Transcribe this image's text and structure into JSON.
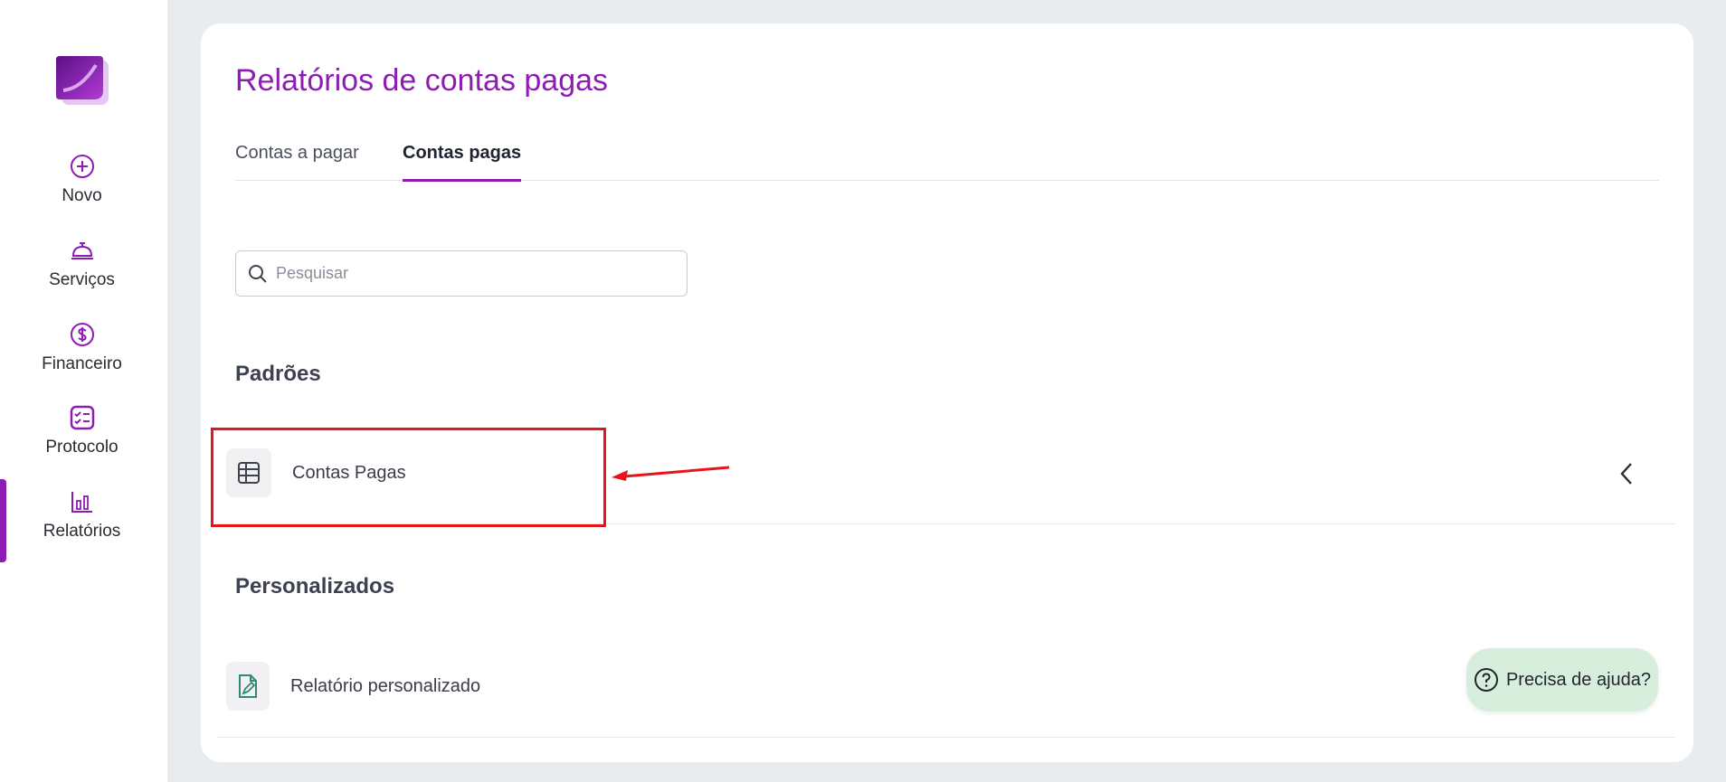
{
  "sidebar": {
    "items": [
      {
        "label": "Novo",
        "icon": "plus-circle-icon"
      },
      {
        "label": "Serviços",
        "icon": "service-bell-icon"
      },
      {
        "label": "Financeiro",
        "icon": "dollar-circle-icon"
      },
      {
        "label": "Protocolo",
        "icon": "checklist-icon"
      },
      {
        "label": "Relatórios",
        "icon": "bar-chart-icon"
      }
    ],
    "active": "Relatórios"
  },
  "main": {
    "title": "Relatórios de contas pagas",
    "tabs": [
      {
        "label": "Contas a pagar",
        "active": false
      },
      {
        "label": "Contas pagas",
        "active": true
      }
    ],
    "search": {
      "placeholder": "Pesquisar",
      "value": ""
    },
    "sections": [
      {
        "title": "Padrões",
        "items": [
          {
            "label": "Contas Pagas",
            "icon": "table-icon"
          }
        ]
      },
      {
        "title": "Personalizados",
        "items": [
          {
            "label": "Relatório personalizado",
            "icon": "edit-file-icon"
          }
        ]
      }
    ]
  },
  "help": {
    "label": "Precisa de ajuda?"
  },
  "colors": {
    "brand": "#8e1bb4",
    "highlight": "#e8141b",
    "help_bg": "#d7eedd",
    "background": "#e9ecef"
  }
}
